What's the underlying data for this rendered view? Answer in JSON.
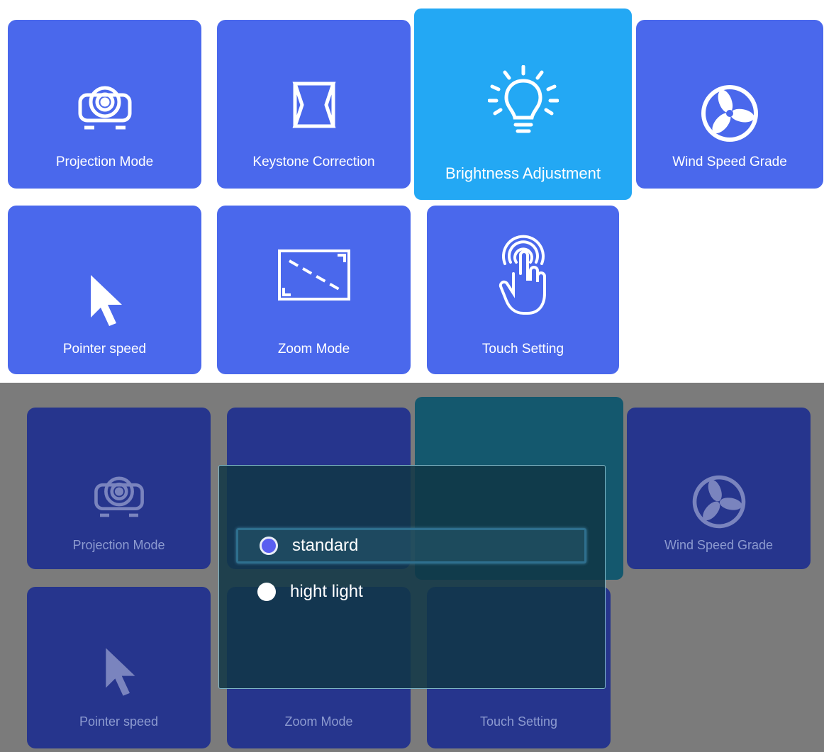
{
  "tiles": [
    {
      "id": "projection",
      "label": "Projection Mode",
      "icon": "projector-icon"
    },
    {
      "id": "keystone",
      "label": "Keystone Correction",
      "icon": "keystone-icon"
    },
    {
      "id": "brightness",
      "label": "Brightness Adjustment",
      "icon": "lightbulb-icon",
      "selected": true
    },
    {
      "id": "wind",
      "label": "Wind Speed Grade",
      "icon": "fan-icon"
    },
    {
      "id": "pointer",
      "label": "Pointer speed",
      "icon": "cursor-icon"
    },
    {
      "id": "zoom",
      "label": "Zoom Mode",
      "icon": "zoom-icon"
    },
    {
      "id": "touch",
      "label": "Touch Setting",
      "icon": "touch-icon"
    }
  ],
  "dialog": {
    "options": [
      {
        "label": "standard",
        "selected": true,
        "focused": true
      },
      {
        "label": "hight light",
        "selected": false,
        "focused": false
      }
    ]
  },
  "colors": {
    "tile": "#4a68ec",
    "tile_selected": "#23a8f4",
    "tile_dimmed": "#26358d",
    "dialog_bg": "#103746",
    "radio_selected": "#5a5ef0"
  }
}
